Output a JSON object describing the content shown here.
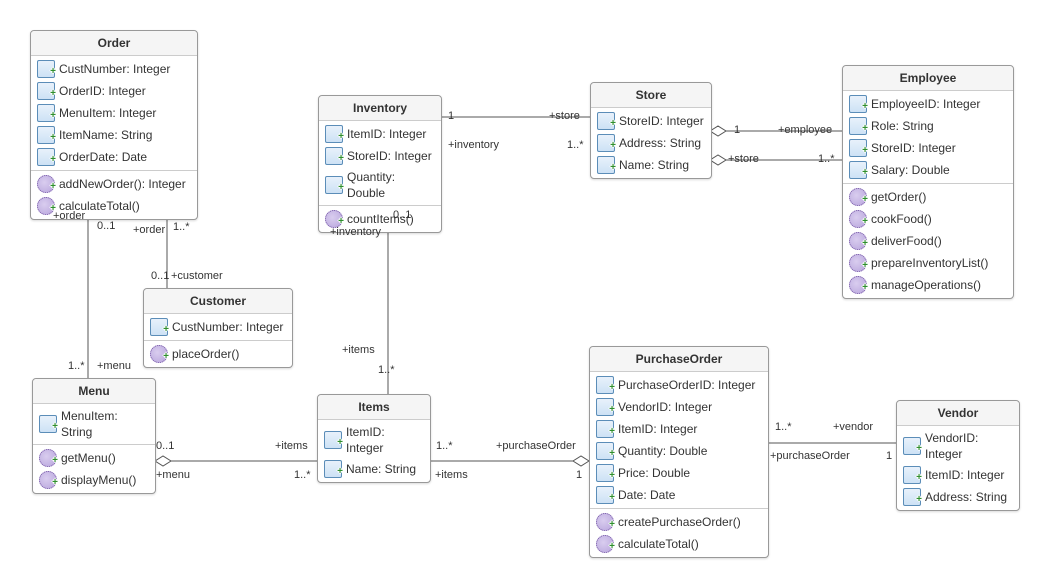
{
  "diagram_type": "UML Class Diagram",
  "classes": {
    "order": {
      "name": "Order",
      "attrs": [
        "CustNumber: Integer",
        "OrderID: Integer",
        "MenuItem: Integer",
        "ItemName: String",
        "OrderDate: Date"
      ],
      "ops": [
        "addNewOrder(): Integer",
        "calculateTotal()"
      ]
    },
    "customer": {
      "name": "Customer",
      "attrs": [
        "CustNumber: Integer"
      ],
      "ops": [
        "placeOrder()"
      ]
    },
    "menu": {
      "name": "Menu",
      "attrs": [
        "MenuItem: String"
      ],
      "ops": [
        "getMenu()",
        "displayMenu()"
      ]
    },
    "inventory": {
      "name": "Inventory",
      "attrs": [
        "ItemID: Integer",
        "StoreID: Integer",
        "Quantity: Double"
      ],
      "ops": [
        "countItems()"
      ]
    },
    "store": {
      "name": "Store",
      "attrs": [
        "StoreID: Integer",
        "Address: String",
        "Name: String"
      ],
      "ops": []
    },
    "employee": {
      "name": "Employee",
      "attrs": [
        "EmployeeID: Integer",
        "Role: String",
        "StoreID: Integer",
        "Salary: Double"
      ],
      "ops": [
        "getOrder()",
        "cookFood()",
        "deliverFood()",
        "prepareInventoryList()",
        "manageOperations()"
      ]
    },
    "items": {
      "name": "Items",
      "attrs": [
        "ItemID: Integer",
        "Name: String"
      ],
      "ops": []
    },
    "purchaseOrder": {
      "name": "PurchaseOrder",
      "attrs": [
        "PurchaseOrderID: Integer",
        "VendorID: Integer",
        "ItemID: Integer",
        "Quantity: Double",
        "Price: Double",
        "Date: Date"
      ],
      "ops": [
        "createPurchaseOrder()",
        "calculateTotal()"
      ]
    },
    "vendor": {
      "name": "Vendor",
      "attrs": [
        "VendorID: Integer",
        "ItemID: Integer",
        "Address: String"
      ],
      "ops": []
    }
  },
  "labels": {
    "inv_store_1": "1",
    "inv_store_store": "+store",
    "inv_store_inventory": "+inventory",
    "inv_store_m": "1..*",
    "store_emp_1": "1",
    "store_emp_emp": "+employee",
    "store_emp_store": "+store",
    "store_emp_m": "1..*",
    "inv_items_inv": "+inventory",
    "inv_items_01": "0..1",
    "inv_items_items": "+items",
    "inv_items_m": "1..*",
    "order_cust_order": "+order",
    "order_cust_01": "0..1",
    "order_cust_01b": "0..1",
    "order_cust_cust": "+customer",
    "order_cust_m": "1..*",
    "order_menu_order": "+order",
    "order_menu_m": "1..*",
    "order_menu_menu": "+menu",
    "menu_items_01": "0..1",
    "menu_items_items": "+items",
    "menu_items_menu_role": "+menu",
    "menu_items_m": "1..*",
    "items_po_m": "1..*",
    "items_po_po": "+purchaseOrder",
    "items_po_items": "+items",
    "items_po_1": "1",
    "po_vendor_m": "1..*",
    "po_vendor_v": "+vendor",
    "po_vendor_po": "+purchaseOrder",
    "po_vendor_1": "1"
  }
}
